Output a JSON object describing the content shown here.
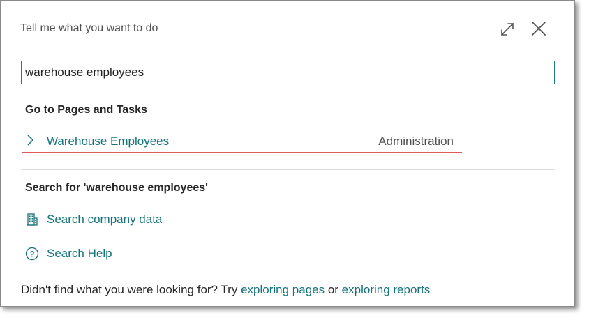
{
  "dialog": {
    "title": "Tell me what you want to do"
  },
  "search": {
    "value": "warehouse employees",
    "placeholder": ""
  },
  "pages_section": {
    "heading": "Go to Pages and Tasks",
    "results": [
      {
        "label": "Warehouse Employees",
        "category": "Administration"
      }
    ]
  },
  "search_section": {
    "heading": "Search for 'warehouse employees'",
    "company_data_label": "Search company data",
    "help_label": "Search Help"
  },
  "footer": {
    "prefix": "Didn't find what you were looking for? Try ",
    "link_pages": "exploring pages",
    "middle": " or ",
    "link_reports": "exploring reports"
  },
  "icons": {
    "expand": "expand-icon",
    "close": "close-icon",
    "chevron": "chevron-right-icon",
    "building": "building-icon",
    "help": "question-circle-icon"
  },
  "colors": {
    "accent": "#14737a",
    "input_border": "#1b7d85",
    "selection_underline": "#e05a5a"
  }
}
